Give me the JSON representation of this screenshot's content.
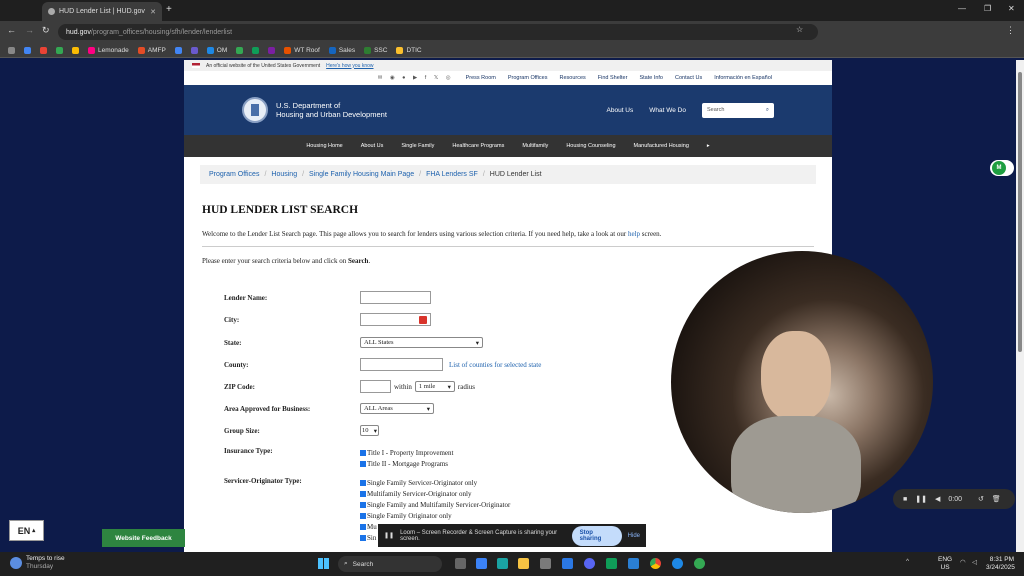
{
  "browser": {
    "tab_title": "HUD Lender List | HUD.gov",
    "url_host": "hud.gov",
    "url_path": "/program_offices/housing/sfh/lender/lenderlist",
    "bookmarks": [
      "Lemonade",
      "AMFP",
      "OM",
      "WT Roof",
      "Sales",
      "SSC",
      "DTIC"
    ]
  },
  "site": {
    "gov_banner": "An official website of the United States Government",
    "gov_banner_link": "Here's how you know",
    "utility_links": [
      "Press Room",
      "Program Offices",
      "Resources",
      "Find Shelter",
      "State Info",
      "Contact Us",
      "Información en Español"
    ],
    "dept_line1": "U.S. Department of",
    "dept_line2": "Housing and Urban Development",
    "header_links": [
      "About Us",
      "What We Do"
    ],
    "search_placeholder": "Search",
    "nav": [
      "Housing Home",
      "About Us",
      "Single Family",
      "Healthcare Programs",
      "Multifamily",
      "Housing Counseling",
      "Manufactured Housing"
    ]
  },
  "breadcrumb": [
    "Program Offices",
    "Housing",
    "Single Family Housing Main Page",
    "FHA Lenders SF",
    "HUD Lender List"
  ],
  "main": {
    "title": "HUD LENDER LIST SEARCH",
    "intro_before": "Welcome to the Lender List Search page. This page allows you to search for lenders using various selection criteria. If you need help, take a look at our",
    "intro_link": "help",
    "intro_after": "screen.",
    "instructions_before": "Please enter your search criteria below and click on",
    "instructions_bold": "Search",
    "instructions_after": "."
  },
  "form": {
    "lender_name_label": "Lender Name:",
    "city_label": "City:",
    "state_label": "State:",
    "state_value": "ALL States",
    "county_label": "County:",
    "county_link": "List of counties for selected state",
    "zip_label": "ZIP Code:",
    "within_text": "within",
    "radius_value": "1 mile",
    "radius_text": "radius",
    "area_label": "Area Approved for Business:",
    "area_value": "ALL Areas",
    "group_label": "Group Size:",
    "group_value": "10",
    "insurance_label": "Insurance Type:",
    "insurance_options": [
      "Title I - Property Improvement",
      "Title II - Mortgage Programs"
    ],
    "servicer_label": "Servicer-Originator Type:",
    "servicer_options": [
      "Single Family Servicer-Originator only",
      "Multifamily Servicer-Originator only",
      "Single Family and Multifamily Servicer-Originator",
      "Single Family Originator only",
      "Mu",
      "Sin"
    ]
  },
  "overlays": {
    "lang": "EN",
    "feedback": "Website Feedback",
    "loom_message": "Loom – Screen Recorder & Screen Capture is sharing your screen.",
    "stop_sharing": "Stop sharing",
    "hide": "Hide",
    "recorder_time": "0:00",
    "extension_badge": "M"
  },
  "taskbar": {
    "weather_line1": "Temps to rise",
    "weather_line2": "Thursday",
    "search": "Search",
    "lang_line1": "ENG",
    "lang_line2": "US",
    "time": "8:31 PM",
    "date": "3/24/2025"
  }
}
